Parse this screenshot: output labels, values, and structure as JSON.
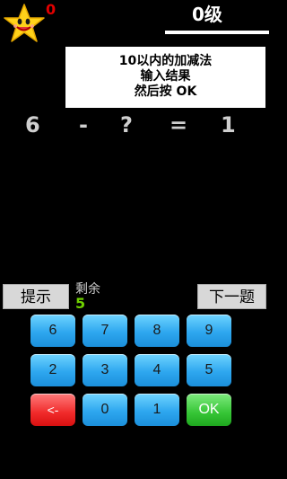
{
  "header": {
    "score": "0",
    "level": "0级"
  },
  "hint": {
    "lines": [
      "10以内的加减法",
      "输入结果",
      "然后按 OK"
    ]
  },
  "equation": {
    "left": "6",
    "op": "-",
    "unknown": "?",
    "eq": "=",
    "right": "1"
  },
  "controls": {
    "hint_label": "提示",
    "next_label": "下一题",
    "remain_label": "剩余",
    "remain_value": "5"
  },
  "keypad": {
    "row1": [
      "6",
      "7",
      "8",
      "9"
    ],
    "row2": [
      "2",
      "3",
      "4",
      "5"
    ],
    "row3": [
      "<-",
      "0",
      "1",
      "OK"
    ]
  },
  "colors": {
    "background": "#000000",
    "key_blue": "#2ea7ef",
    "key_red": "#f02a2a",
    "key_green": "#36c536",
    "remain_green": "#6ed000",
    "score_red": "#e00000"
  }
}
